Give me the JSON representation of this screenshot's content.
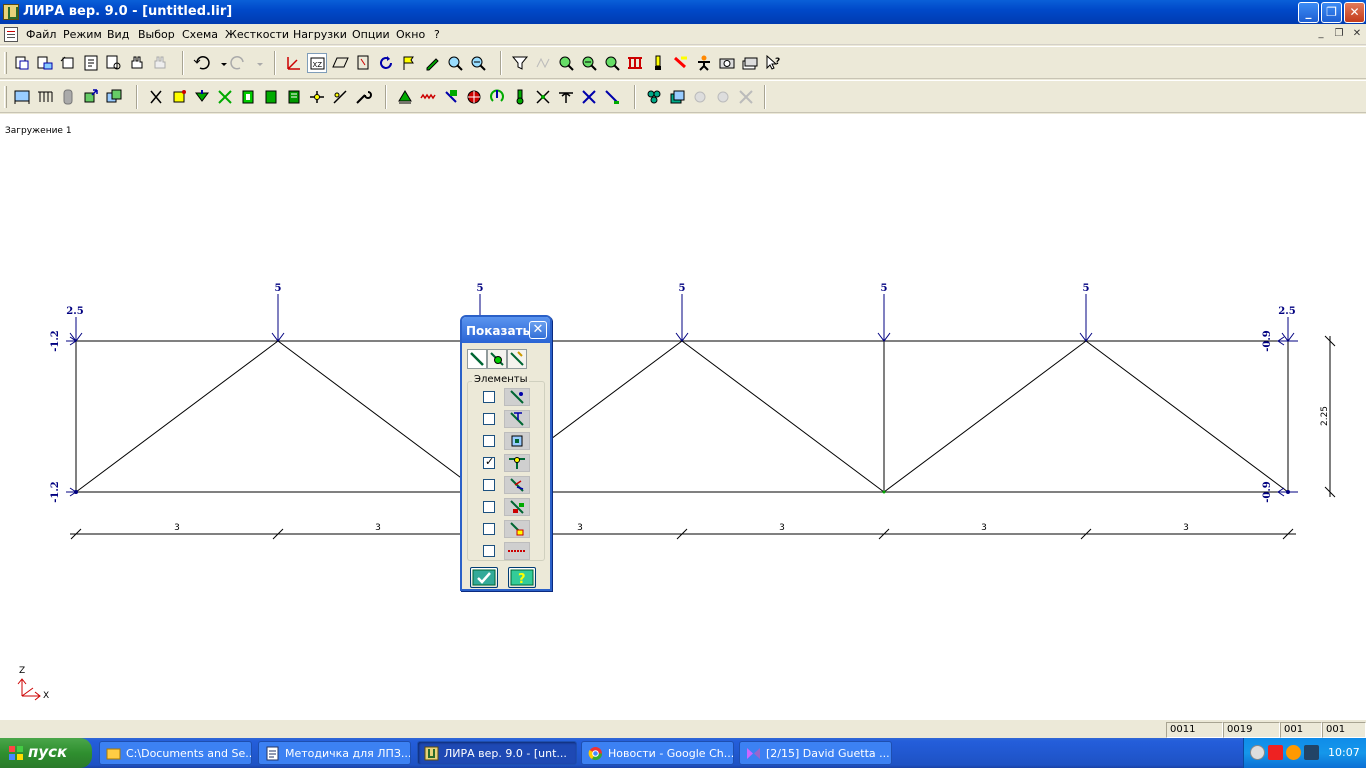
{
  "window": {
    "title": "ЛИРА  вер. 9.0 - [untitled.lir]",
    "minimize": "_",
    "maximize": "❐",
    "close": "✕"
  },
  "menu": {
    "items": [
      "Файл",
      "Режим",
      "Вид",
      "Выбор",
      "Схема",
      "Жесткости",
      "Нагрузки",
      "Опции",
      "Окно",
      "?"
    ]
  },
  "canvas": {
    "load_case": "Загружение  1",
    "top_loads": [
      "2.5",
      "5",
      "5",
      "5",
      "5",
      "5",
      "2.5"
    ],
    "left_side_labels": [
      "-1.2",
      "-1.2"
    ],
    "right_side_labels": [
      "-0.9",
      "-0.9"
    ],
    "span_labels": [
      "3",
      "3",
      "3",
      "3",
      "3",
      "3"
    ],
    "height_label": "2.25",
    "axis_z": "Z",
    "axis_x": "X"
  },
  "dialog": {
    "title": "Показать",
    "group_label": "Элементы",
    "checks": [
      false,
      false,
      false,
      true,
      false,
      false,
      false,
      false
    ]
  },
  "statusbar": {
    "cells": [
      "0011",
      "0019",
      "001",
      "001"
    ]
  },
  "taskbar": {
    "start": "пуск",
    "tasks": [
      "C:\\Documents and Se...",
      "Методичка для ЛПЗ....",
      "ЛИРА  вер. 9.0 - [unt...",
      "Новости - Google Ch...",
      "[2/15] David Guetta ..."
    ],
    "clock": "10:07"
  },
  "colors": {
    "load_labels": "#000080",
    "structure": "#000000",
    "title_bar": "#0a5fd8",
    "canvas_bg": "#ffffff"
  }
}
